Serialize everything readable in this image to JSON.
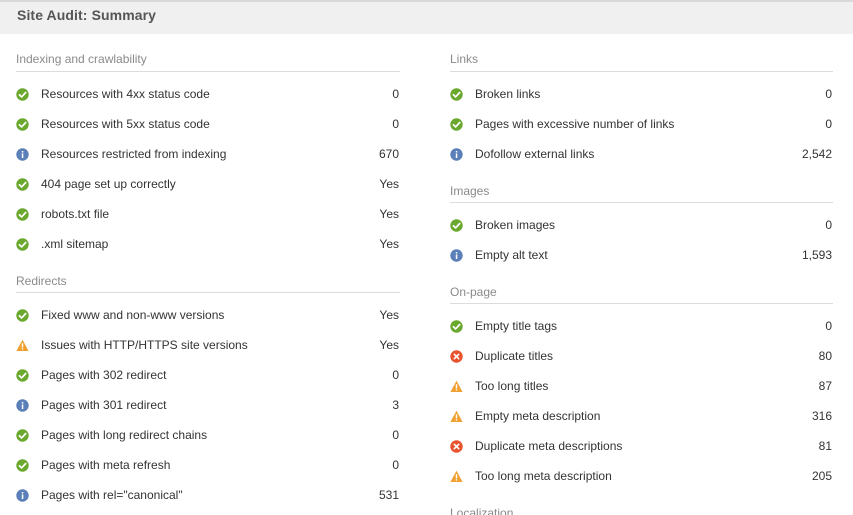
{
  "header": {
    "title": "Site Audit: Summary"
  },
  "colors": {
    "ok": "#6aa82e",
    "info": "#5b7fb8",
    "warning": "#f0a030",
    "error": "#e8532d"
  },
  "left": {
    "sections": [
      {
        "title": "Indexing and crawlability",
        "rows": [
          {
            "status": "ok",
            "label": "Resources with 4xx status code",
            "value": "0"
          },
          {
            "status": "ok",
            "label": "Resources with 5xx status code",
            "value": "0"
          },
          {
            "status": "info",
            "label": "Resources restricted from indexing",
            "value": "670"
          },
          {
            "status": "ok",
            "label": "404 page set up correctly",
            "value": "Yes"
          },
          {
            "status": "ok",
            "label": "robots.txt file",
            "value": "Yes"
          },
          {
            "status": "ok",
            "label": ".xml sitemap",
            "value": "Yes"
          }
        ]
      },
      {
        "title": "Redirects",
        "rows": [
          {
            "status": "ok",
            "label": "Fixed www and non-www versions",
            "value": "Yes"
          },
          {
            "status": "warning",
            "label": "Issues with HTTP/HTTPS site versions",
            "value": "Yes"
          },
          {
            "status": "ok",
            "label": "Pages with 302 redirect",
            "value": "0"
          },
          {
            "status": "info",
            "label": "Pages with 301 redirect",
            "value": "3"
          },
          {
            "status": "ok",
            "label": "Pages with long redirect chains",
            "value": "0"
          },
          {
            "status": "ok",
            "label": "Pages with meta refresh",
            "value": "0"
          },
          {
            "status": "info",
            "label": "Pages with rel=\"canonical\"",
            "value": "531"
          }
        ]
      }
    ]
  },
  "right": {
    "sections": [
      {
        "title": "Links",
        "rows": [
          {
            "status": "ok",
            "label": "Broken links",
            "value": "0"
          },
          {
            "status": "ok",
            "label": "Pages with excessive number of links",
            "value": "0"
          },
          {
            "status": "info",
            "label": "Dofollow external links",
            "value": "2,542"
          }
        ]
      },
      {
        "title": "Images",
        "rows": [
          {
            "status": "ok",
            "label": "Broken images",
            "value": "0"
          },
          {
            "status": "info",
            "label": "Empty alt text",
            "value": "1,593"
          }
        ]
      },
      {
        "title": "On-page",
        "rows": [
          {
            "status": "ok",
            "label": "Empty title tags",
            "value": "0"
          },
          {
            "status": "error",
            "label": "Duplicate titles",
            "value": "80"
          },
          {
            "status": "warning",
            "label": "Too long titles",
            "value": "87"
          },
          {
            "status": "warning",
            "label": "Empty meta description",
            "value": "316"
          },
          {
            "status": "error",
            "label": "Duplicate meta descriptions",
            "value": "81"
          },
          {
            "status": "warning",
            "label": "Too long meta description",
            "value": "205"
          }
        ]
      },
      {
        "title": "Localization",
        "rows": []
      }
    ]
  }
}
